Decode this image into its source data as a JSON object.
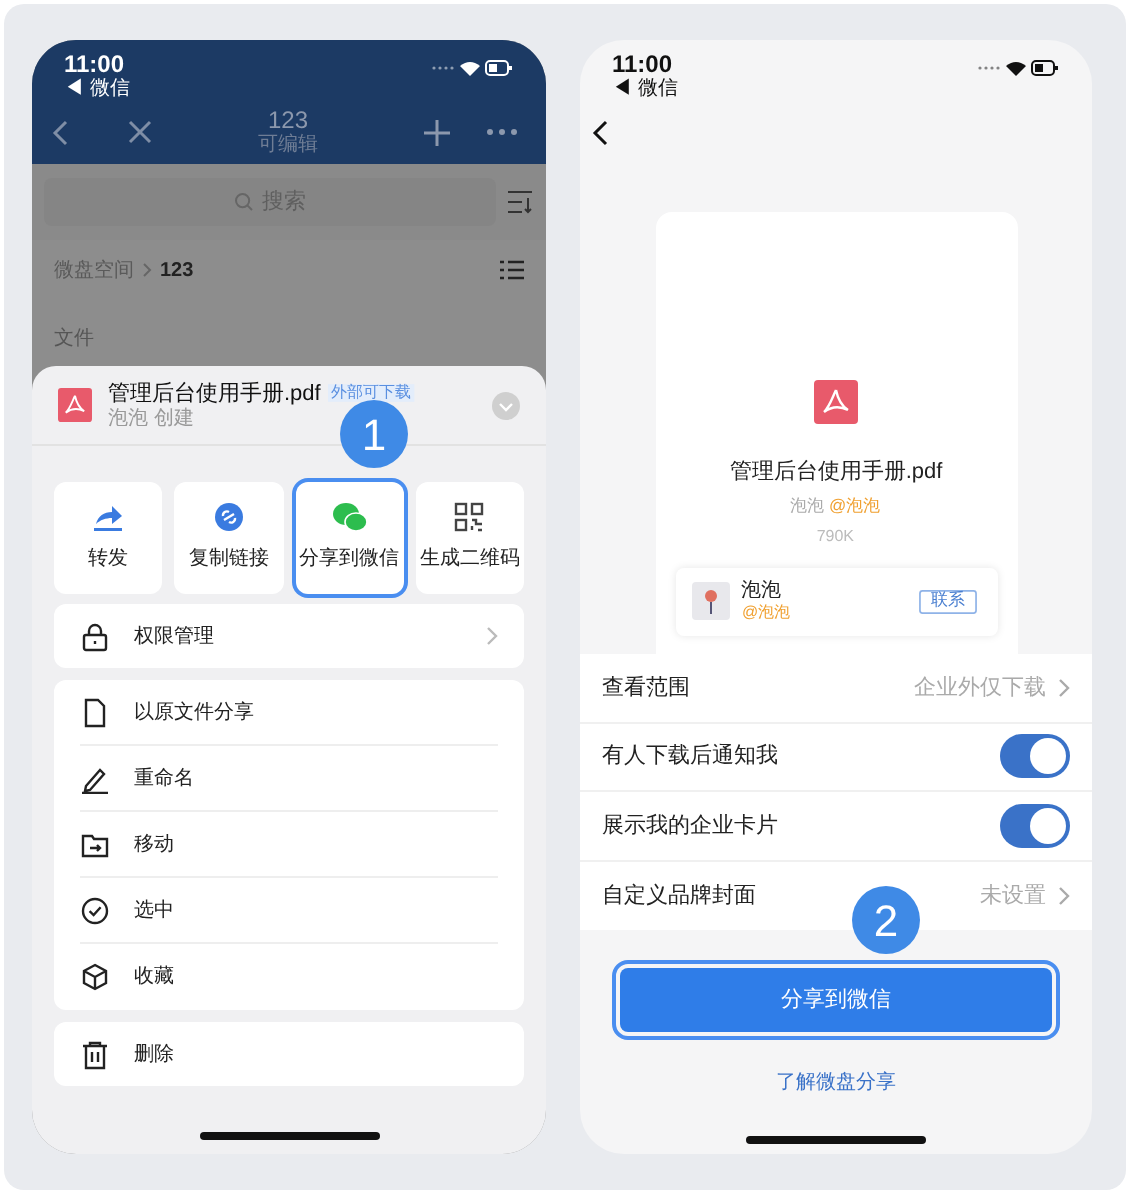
{
  "left_phone": {
    "status_bar": {
      "time": "11:00",
      "back_app": "◀ 微信"
    },
    "nav": {
      "title": "123",
      "subtitle": "可编辑"
    },
    "search": {
      "placeholder": "搜索"
    },
    "breadcrumb": [
      {
        "label": "微盘空间",
        "current": false
      },
      {
        "label": "123",
        "current": true
      }
    ],
    "section_label": "文件",
    "sheet": {
      "file": {
        "name": "管理后台使用手册.pdf",
        "tag": "外部可下载",
        "meta": "泡泡 创建"
      },
      "step_badge": "1",
      "actions": [
        {
          "kind": "forward",
          "label": "转发",
          "selected": false
        },
        {
          "kind": "link",
          "label": "复制链接",
          "selected": false
        },
        {
          "kind": "wechat",
          "label": "分享到微信",
          "selected": true
        },
        {
          "kind": "qrcode",
          "label": "生成二维码",
          "selected": false
        }
      ],
      "permission": {
        "label": "权限管理"
      },
      "menu": [
        {
          "kind": "file",
          "label": "以原文件分享"
        },
        {
          "kind": "rename",
          "label": "重命名"
        },
        {
          "kind": "move",
          "label": "移动"
        },
        {
          "kind": "select",
          "label": "选中"
        },
        {
          "kind": "favorite",
          "label": "收藏"
        }
      ],
      "delete": {
        "label": "删除"
      }
    }
  },
  "right_phone": {
    "status_bar": {
      "time": "11:00",
      "back_app": "◀ 微信"
    },
    "preview": {
      "file_name": "管理后台使用手册.pdf",
      "owner": "泡泡",
      "owner_tag": "@泡泡",
      "size": "790K",
      "card": {
        "name": "泡泡",
        "org": "@泡泡",
        "button": "联系"
      }
    },
    "settings": [
      {
        "kind": "link",
        "label": "查看范围",
        "value": "企业外仅下载"
      },
      {
        "kind": "toggle",
        "label": "有人下载后通知我",
        "on": true
      },
      {
        "kind": "toggle",
        "label": "展示我的企业卡片",
        "on": true
      },
      {
        "kind": "link",
        "label": "自定义品牌封面",
        "value": "未设置"
      }
    ],
    "step_badge": "2",
    "share_button": "分享到微信",
    "learn_link": "了解微盘分享"
  }
}
